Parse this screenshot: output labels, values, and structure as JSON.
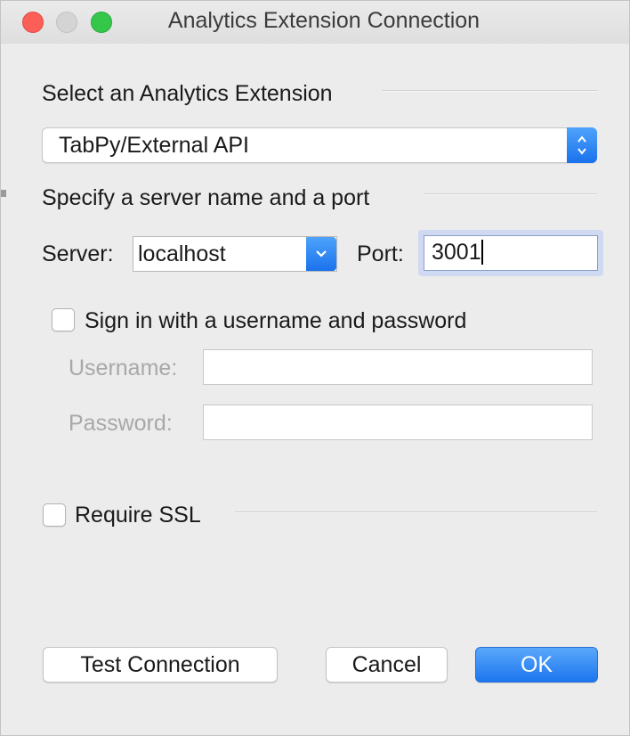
{
  "window": {
    "title": "Analytics Extension Connection"
  },
  "extension_section": {
    "label": "Select an Analytics Extension",
    "selected_value": "TabPy/External API"
  },
  "server_section": {
    "label": "Specify a server name and a port",
    "server_label": "Server:",
    "server_value": "localhost",
    "port_label": "Port:",
    "port_value": "3001"
  },
  "auth": {
    "checkbox_label": "Sign in with a username and password",
    "checked": false,
    "username_label": "Username:",
    "username_value": "",
    "password_label": "Password:",
    "password_value": ""
  },
  "ssl": {
    "checkbox_label": "Require SSL",
    "checked": false
  },
  "buttons": {
    "test_connection": "Test Connection",
    "cancel": "Cancel",
    "ok": "OK"
  },
  "colors": {
    "accent": "#1a72ec",
    "close": "#fc5f57",
    "zoom": "#34c749"
  }
}
